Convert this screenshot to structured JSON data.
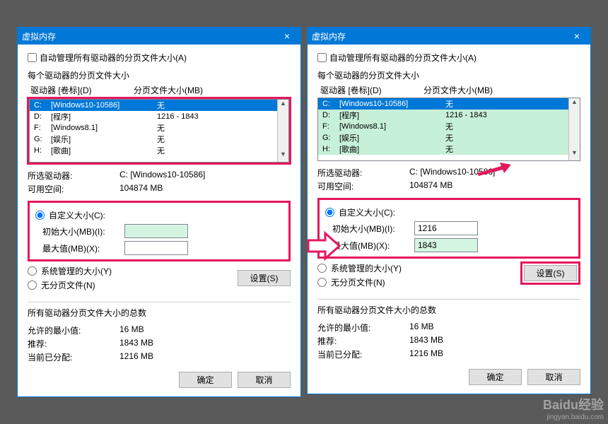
{
  "dialog_title": "虚拟内存",
  "auto_label": "自动管理所有驱动器的分页文件大小(A)",
  "each_title": "每个驱动器的分页文件大小",
  "col_drive": "驱动器 [卷标](D)",
  "col_pf": "分页文件大小(MB)",
  "drives": [
    {
      "letter": "C:",
      "label": "[Windows10-10586]",
      "pf": "无"
    },
    {
      "letter": "D:",
      "label": "[程序]",
      "pf": "1216 - 1843"
    },
    {
      "letter": "F:",
      "label": "[Windows8.1]",
      "pf": "无"
    },
    {
      "letter": "G:",
      "label": "[娱乐]",
      "pf": "无"
    },
    {
      "letter": "H:",
      "label": "[歌曲]",
      "pf": "无"
    }
  ],
  "sel_drive_k": "所选驱动器:",
  "sel_drive_v": "C:  [Windows10-10586]",
  "free_k": "可用空间:",
  "free_v": "104874 MB",
  "custom_label": "自定义大小(C):",
  "init_label": "初始大小(MB)(I):",
  "max_label": "最大值(MB)(X):",
  "sys_label": "系统管理的大小(Y)",
  "none_label": "无分页文件(N)",
  "set_btn": "设置(S)",
  "totals_title": "所有驱动器分页文件大小的总数",
  "min_k": "允许的最小值:",
  "min_v": "16 MB",
  "rec_k": "推荐:",
  "rec_v": "1843 MB",
  "cur_k": "当前已分配:",
  "cur_v": "1216 MB",
  "ok": "确定",
  "cancel": "取消",
  "left": {
    "init": "",
    "max": "",
    "init_green": true,
    "highlight_set": false
  },
  "right": {
    "init": "1216",
    "max": "1843",
    "init_green": false,
    "highlight_set": true
  },
  "watermark1": "Baidu经验",
  "watermark2": "jingyan.baidu.com"
}
